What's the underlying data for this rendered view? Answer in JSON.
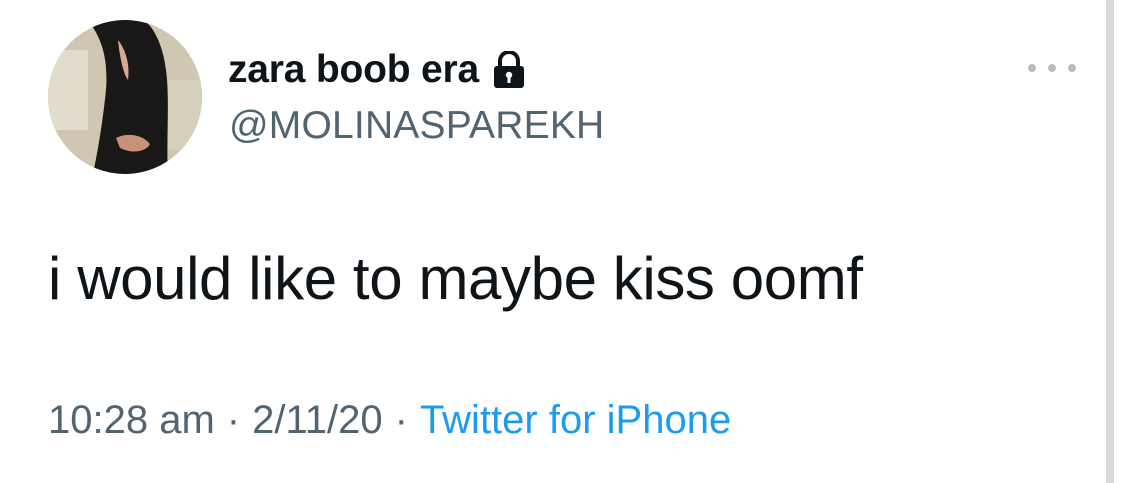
{
  "user": {
    "display_name": "zara boob era",
    "handle": "@MOLINASPAREKH",
    "avatar_icon": "profile-photo",
    "lock_icon": "lock-icon"
  },
  "tweet": {
    "text": "i would like to maybe kiss oomf"
  },
  "meta": {
    "time": "10:28 am",
    "separator": "·",
    "date": "2/11/20",
    "source": "Twitter for iPhone"
  },
  "menu": {
    "icon": "more-options-icon"
  },
  "colors": {
    "text_primary": "#0f1419",
    "text_secondary": "#536471",
    "link": "#1d9bf0",
    "background": "#ffffff"
  }
}
